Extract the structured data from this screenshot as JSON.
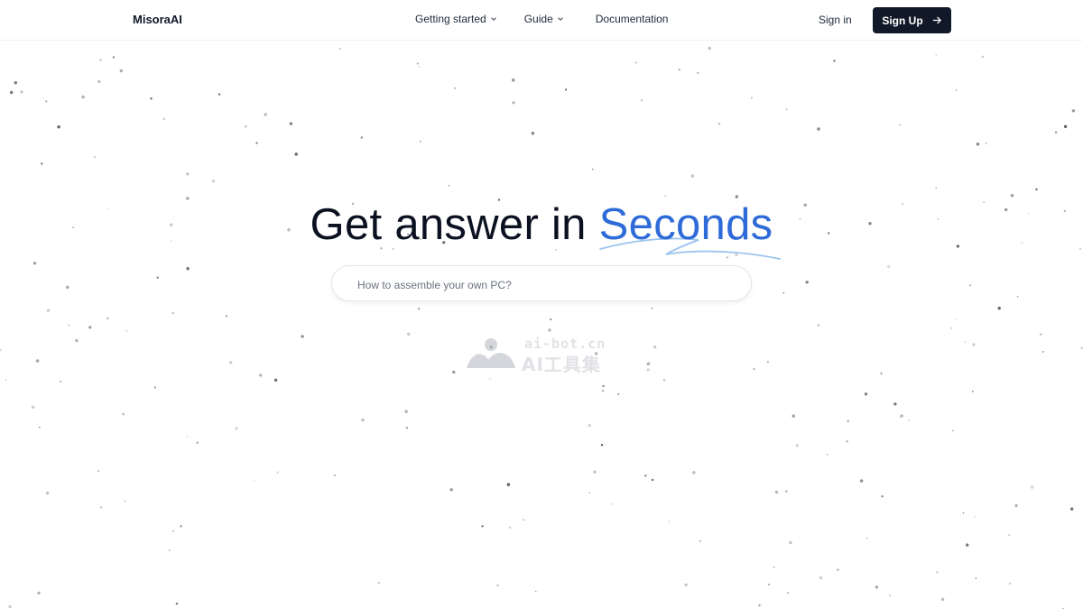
{
  "header": {
    "logo": "MisoraAI",
    "nav": [
      {
        "label": "Getting started",
        "has_dropdown": true
      },
      {
        "label": "Guide",
        "has_dropdown": true
      },
      {
        "label": "Documentation",
        "has_dropdown": false
      }
    ],
    "sign_in": "Sign in",
    "sign_up": "Sign Up"
  },
  "hero": {
    "title_prefix": "Get answer in ",
    "title_accent": "Seconds"
  },
  "search": {
    "placeholder": "How to assemble your own PC?"
  },
  "watermark": {
    "line1": "ai-bot.cn",
    "line2": "AI工具集"
  },
  "colors": {
    "accent": "#2f6bd8",
    "button_bg": "#111827",
    "text": "#0f172a"
  }
}
